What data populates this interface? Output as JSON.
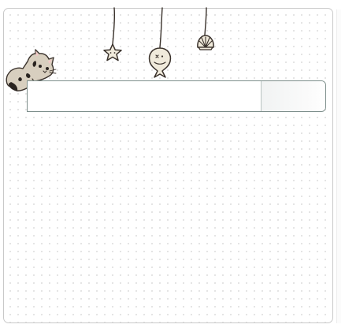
{
  "search": {
    "input_value": "",
    "placeholder": "",
    "button_label": ""
  },
  "decorations": {
    "cat": "cat-illustration",
    "hanging_items": [
      "star-charm",
      "fish-charm",
      "shell-charm"
    ]
  },
  "colors": {
    "border": "#7d8e8b",
    "card_border": "#c9c9c9",
    "line": "#3a322c",
    "charm_fill": "#f0eadb",
    "cat_fill": "#d8cfbf",
    "cat_spot": "#2a2420"
  }
}
